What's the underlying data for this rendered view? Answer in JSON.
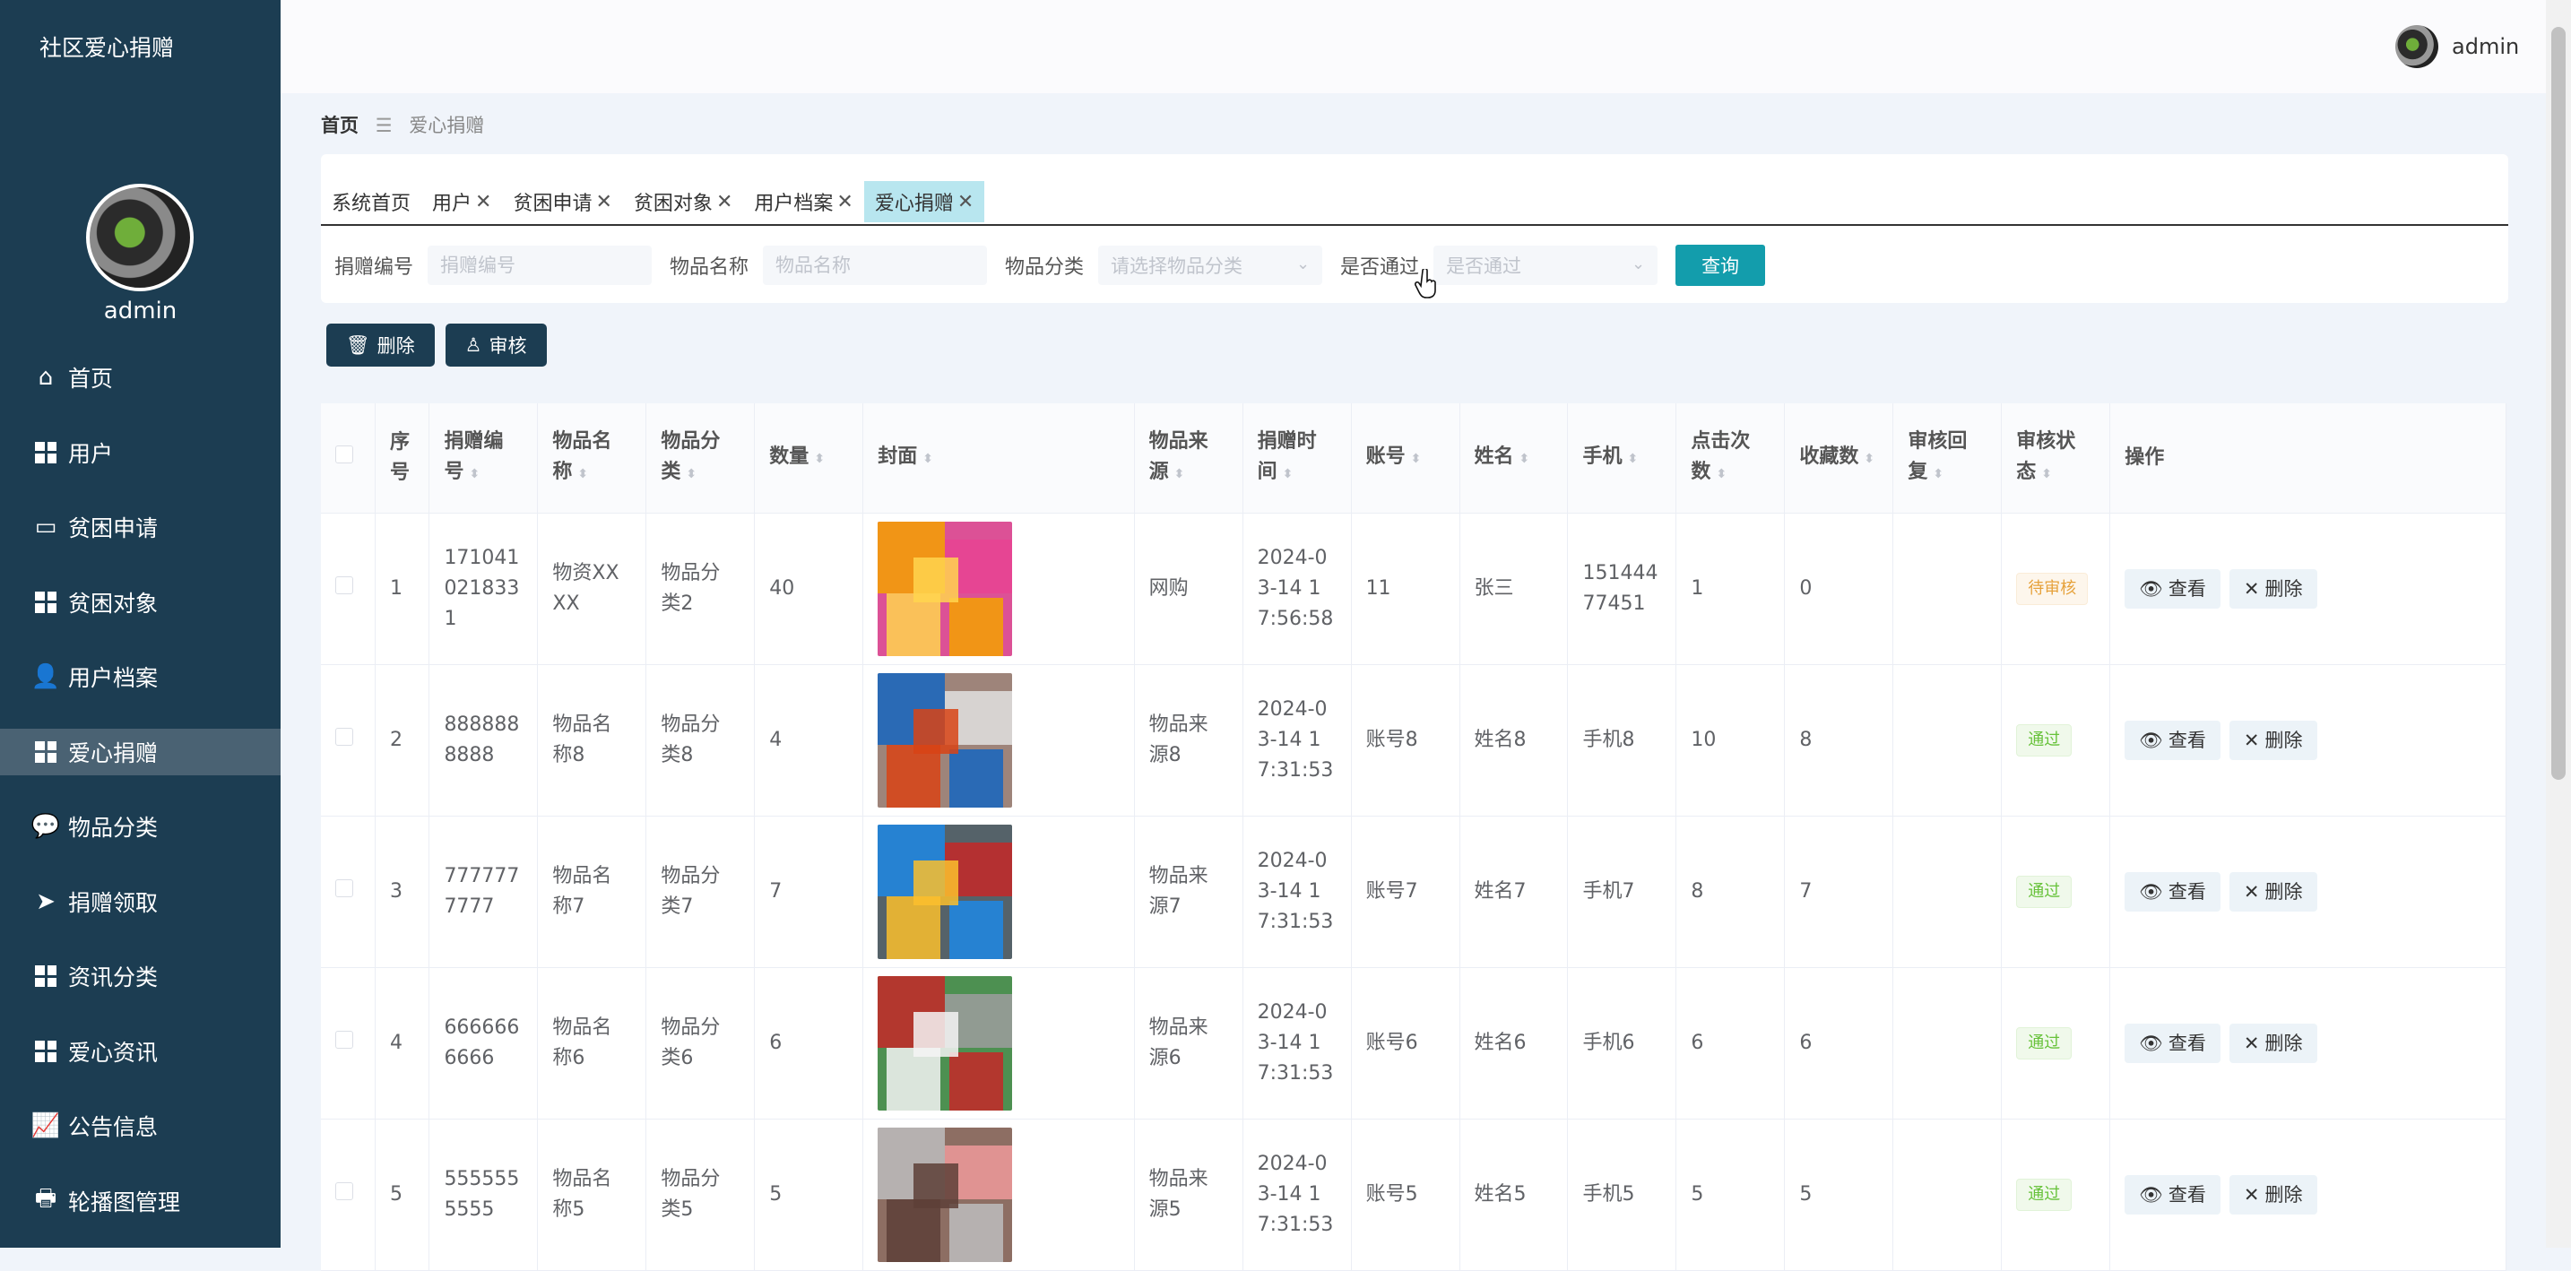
{
  "app": {
    "title": "社区爱心捐赠"
  },
  "sidebar": {
    "user": "admin",
    "items": [
      {
        "label": "首页",
        "icon": "home-icon"
      },
      {
        "label": "用户",
        "icon": "grid-icon"
      },
      {
        "label": "贫困申请",
        "icon": "monitor-icon"
      },
      {
        "label": "贫困对象",
        "icon": "grid-icon"
      },
      {
        "label": "用户档案",
        "icon": "user-icon"
      },
      {
        "label": "爱心捐赠",
        "icon": "grid-icon"
      },
      {
        "label": "物品分类",
        "icon": "chat-icon"
      },
      {
        "label": "捐赠领取",
        "icon": "send-icon"
      },
      {
        "label": "资讯分类",
        "icon": "grid-icon"
      },
      {
        "label": "爱心资讯",
        "icon": "grid-icon"
      },
      {
        "label": "公告信息",
        "icon": "chart-icon"
      },
      {
        "label": "轮播图管理",
        "icon": "printer-icon"
      }
    ]
  },
  "header": {
    "user": "admin"
  },
  "breadcrumb": {
    "home": "首页",
    "current": "爱心捐赠"
  },
  "tabs": [
    {
      "label": "系统首页",
      "closable": false
    },
    {
      "label": "用户",
      "closable": true
    },
    {
      "label": "贫困申请",
      "closable": true
    },
    {
      "label": "贫困对象",
      "closable": true
    },
    {
      "label": "用户档案",
      "closable": true
    },
    {
      "label": "爱心捐赠",
      "closable": true
    }
  ],
  "filters": {
    "donation_no": {
      "label": "捐赠编号",
      "placeholder": "捐赠编号"
    },
    "item_name": {
      "label": "物品名称",
      "placeholder": "物品名称"
    },
    "category": {
      "label": "物品分类",
      "placeholder": "请选择物品分类"
    },
    "approved": {
      "label": "是否通过",
      "placeholder": "是否通过"
    },
    "query_label": "查询"
  },
  "actions": {
    "delete_label": "删除",
    "review_label": "审核"
  },
  "table": {
    "headers": [
      "序号",
      "捐赠编号",
      "物品名称",
      "物品分类",
      "数量",
      "封面",
      "物品来源",
      "捐赠时间",
      "账号",
      "姓名",
      "手机",
      "点击次数",
      "收藏数",
      "审核回复",
      "审核状态",
      "操作"
    ],
    "view_label": "查看",
    "delete_label": "删除",
    "rows": [
      {
        "idx": "1",
        "no": "1710410218331",
        "name": "物资XXXX",
        "cat": "物品分类2",
        "qty": "40",
        "source": "网购",
        "time": "2024-03-14 17:56:58",
        "account": "11",
        "person": "张三",
        "phone": "15144477451",
        "clicks": "1",
        "favs": "0",
        "reply": "",
        "status": "待审核",
        "status_type": "pending"
      },
      {
        "idx": "2",
        "no": "8888888888",
        "name": "物品名称8",
        "cat": "物品分类8",
        "qty": "4",
        "source": "物品来源8",
        "time": "2024-03-14 17:31:53",
        "account": "账号8",
        "person": "姓名8",
        "phone": "手机8",
        "clicks": "10",
        "favs": "8",
        "reply": "",
        "status": "通过",
        "status_type": "pass"
      },
      {
        "idx": "3",
        "no": "7777777777",
        "name": "物品名称7",
        "cat": "物品分类7",
        "qty": "7",
        "source": "物品来源7",
        "time": "2024-03-14 17:31:53",
        "account": "账号7",
        "person": "姓名7",
        "phone": "手机7",
        "clicks": "8",
        "favs": "7",
        "reply": "",
        "status": "通过",
        "status_type": "pass"
      },
      {
        "idx": "4",
        "no": "6666666666",
        "name": "物品名称6",
        "cat": "物品分类6",
        "qty": "6",
        "source": "物品来源6",
        "time": "2024-03-14 17:31:53",
        "account": "账号6",
        "person": "姓名6",
        "phone": "手机6",
        "clicks": "6",
        "favs": "6",
        "reply": "",
        "status": "通过",
        "status_type": "pass"
      },
      {
        "idx": "5",
        "no": "5555555555",
        "name": "物品名称5",
        "cat": "物品分类5",
        "qty": "5",
        "source": "物品来源5",
        "time": "2024-03-14 17:31:53",
        "account": "账号5",
        "person": "姓名5",
        "phone": "手机5",
        "clicks": "5",
        "favs": "5",
        "reply": "",
        "status": "通过",
        "status_type": "pass"
      }
    ]
  }
}
